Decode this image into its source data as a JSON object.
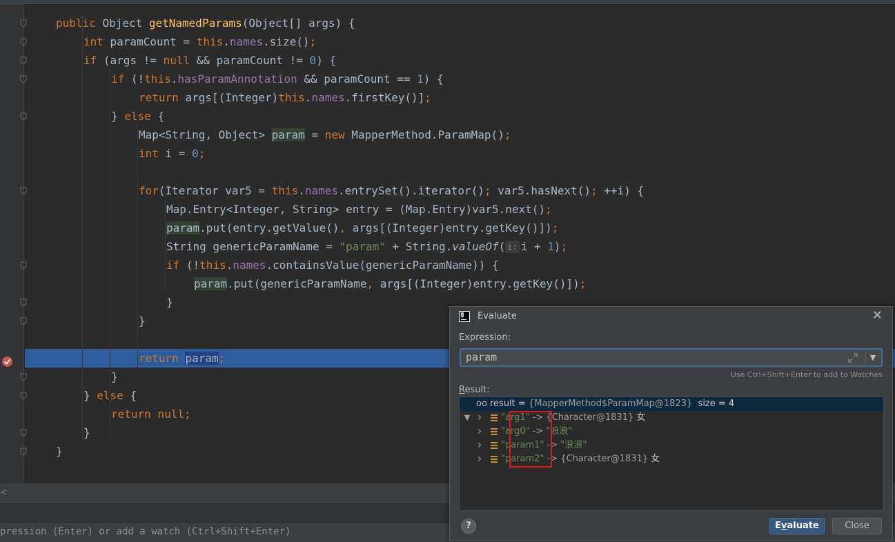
{
  "code_lines": [
    {
      "indent": 1,
      "segments": [
        [
          "k",
          "public "
        ],
        [
          "t",
          "Object "
        ],
        [
          "m",
          "getNamedParams"
        ],
        [
          "t",
          "(Object[] args) {"
        ]
      ]
    },
    {
      "indent": 2,
      "segments": [
        [
          "k",
          "int "
        ],
        [
          "t",
          "paramCount = "
        ],
        [
          "k",
          "this"
        ],
        [
          "t",
          "."
        ],
        [
          "f",
          "names"
        ],
        [
          "t",
          ".size()"
        ],
        [
          "k",
          ";"
        ]
      ]
    },
    {
      "indent": 2,
      "segments": [
        [
          "k",
          "if "
        ],
        [
          "t",
          "(args != "
        ],
        [
          "k",
          "null "
        ],
        [
          "t",
          "&& paramCount != "
        ],
        [
          "n",
          "0"
        ],
        [
          "t",
          ") {"
        ]
      ]
    },
    {
      "indent": 3,
      "segments": [
        [
          "k",
          "if "
        ],
        [
          "t",
          "(!"
        ],
        [
          "k",
          "this"
        ],
        [
          "t",
          "."
        ],
        [
          "f",
          "hasParamAnnotation "
        ],
        [
          "t",
          "&& paramCount == "
        ],
        [
          "n",
          "1"
        ],
        [
          "t",
          ") {"
        ]
      ]
    },
    {
      "indent": 4,
      "segments": [
        [
          "k",
          "return "
        ],
        [
          "t",
          "args[(Integer)"
        ],
        [
          "k",
          "this"
        ],
        [
          "t",
          "."
        ],
        [
          "f",
          "names"
        ],
        [
          "t",
          ".firstKey()]"
        ],
        [
          "k",
          ";"
        ]
      ]
    },
    {
      "indent": 3,
      "segments": [
        [
          "t",
          "} "
        ],
        [
          "k",
          "else "
        ],
        [
          "t",
          "{"
        ]
      ]
    },
    {
      "indent": 4,
      "segments": [
        [
          "t",
          "Map<String, Object> "
        ],
        [
          "hl",
          "param"
        ],
        [
          "t",
          " = "
        ],
        [
          "k",
          "new "
        ],
        [
          "t",
          "MapperMethod.ParamMap()"
        ],
        [
          "k",
          ";"
        ]
      ]
    },
    {
      "indent": 4,
      "segments": [
        [
          "k",
          "int "
        ],
        [
          "t",
          "i = "
        ],
        [
          "n",
          "0"
        ],
        [
          "k",
          ";"
        ]
      ]
    },
    {
      "indent": 0,
      "segments": []
    },
    {
      "indent": 4,
      "segments": [
        [
          "k",
          "for"
        ],
        [
          "t",
          "(Iterator var5 = "
        ],
        [
          "k",
          "this"
        ],
        [
          "t",
          "."
        ],
        [
          "f",
          "names"
        ],
        [
          "t",
          ".entrySet().iterator()"
        ],
        [
          "k",
          "; "
        ],
        [
          "t",
          "var5.hasNext()"
        ],
        [
          "k",
          "; "
        ],
        [
          "t",
          "++i) {"
        ]
      ]
    },
    {
      "indent": 5,
      "segments": [
        [
          "t",
          "Map.Entry<Integer, String> entry = (Map.Entry)var5.next()"
        ],
        [
          "k",
          ";"
        ]
      ]
    },
    {
      "indent": 5,
      "segments": [
        [
          "hl",
          "param"
        ],
        [
          "t",
          ".put(entry.getValue()"
        ],
        [
          "k",
          ", "
        ],
        [
          "t",
          "args[(Integer)entry.getKey()])"
        ],
        [
          "k",
          ";"
        ]
      ]
    },
    {
      "indent": 5,
      "segments": [
        [
          "t",
          "String genericParamName = "
        ],
        [
          "s",
          "\"param\" "
        ],
        [
          "t",
          "+ String."
        ],
        [
          "i",
          "valueOf"
        ],
        [
          "t",
          "("
        ],
        [
          "hint",
          "i:"
        ],
        [
          "t",
          "i + "
        ],
        [
          "n",
          "1"
        ],
        [
          "t",
          ")"
        ],
        [
          "k",
          ";"
        ]
      ]
    },
    {
      "indent": 5,
      "segments": [
        [
          "k",
          "if "
        ],
        [
          "t",
          "(!"
        ],
        [
          "k",
          "this"
        ],
        [
          "t",
          "."
        ],
        [
          "f",
          "names"
        ],
        [
          "t",
          ".containsValue(genericParamName)) {"
        ]
      ]
    },
    {
      "indent": 6,
      "segments": [
        [
          "hl",
          "param"
        ],
        [
          "t",
          ".put(genericParamName"
        ],
        [
          "k",
          ", "
        ],
        [
          "t",
          "args[(Integer)entry.getKey()])"
        ],
        [
          "k",
          ";"
        ]
      ]
    },
    {
      "indent": 5,
      "segments": [
        [
          "t",
          "}"
        ]
      ]
    },
    {
      "indent": 4,
      "segments": [
        [
          "t",
          "}"
        ]
      ]
    },
    {
      "indent": 0,
      "segments": []
    },
    {
      "indent": 4,
      "segments": [
        [
          "k",
          "return "
        ],
        [
          "hlb",
          "param"
        ],
        [
          "k",
          ";"
        ]
      ]
    },
    {
      "indent": 3,
      "segments": [
        [
          "t",
          "}"
        ]
      ]
    },
    {
      "indent": 2,
      "segments": [
        [
          "t",
          "} "
        ],
        [
          "k",
          "else "
        ],
        [
          "t",
          "{"
        ]
      ]
    },
    {
      "indent": 3,
      "segments": [
        [
          "k",
          "return null;"
        ]
      ]
    },
    {
      "indent": 2,
      "segments": [
        [
          "t",
          "}"
        ]
      ]
    },
    {
      "indent": 1,
      "segments": [
        [
          "t",
          "}"
        ]
      ]
    }
  ],
  "panel": {
    "watch_hint": "pression (Enter) or add a watch (Ctrl+Shift+Enter)",
    "collapse_arrow": "<"
  },
  "dialog": {
    "app_icon_text": "IJ",
    "title": "Evaluate",
    "close_glyph": "✕",
    "expression_label": "Expression:",
    "expression_value": "param",
    "watch_note": "Use Ctrl+Shift+Enter to add to Watches",
    "result_label": "Result:",
    "result_root": {
      "name": "result",
      "value": "{MapperMethod$ParamMap@1823}",
      "size": "size = 4"
    },
    "entries": [
      {
        "key": "\"arg1\"",
        "arrow": " -> ",
        "value": "{Character@1831}",
        "extra": " 女",
        "string_value": false
      },
      {
        "key": "\"arg0\"",
        "arrow": " -> ",
        "value": "\"浪浪\"",
        "extra": "",
        "string_value": true
      },
      {
        "key": "\"param1\"",
        "arrow": " -> ",
        "value": "\"浪浪\"",
        "extra": "",
        "string_value": true
      },
      {
        "key": "\"param2\"",
        "arrow": " -> ",
        "value": "{Character@1831}",
        "extra": " 女",
        "string_value": false
      }
    ],
    "help_label": "?",
    "evaluate_button": {
      "hotkey": "v",
      "rest_before": "E",
      "rest_after": "aluate"
    },
    "close_button": "Close"
  },
  "colors": {
    "editor_bg": "#2b2b2b",
    "exec_line": "#2d5d9a",
    "keyword": "#cc7832",
    "method": "#ffc66d",
    "field": "#9876aa",
    "number": "#6897bb",
    "string": "#6a8759",
    "highlight_box": "#e0191f"
  }
}
